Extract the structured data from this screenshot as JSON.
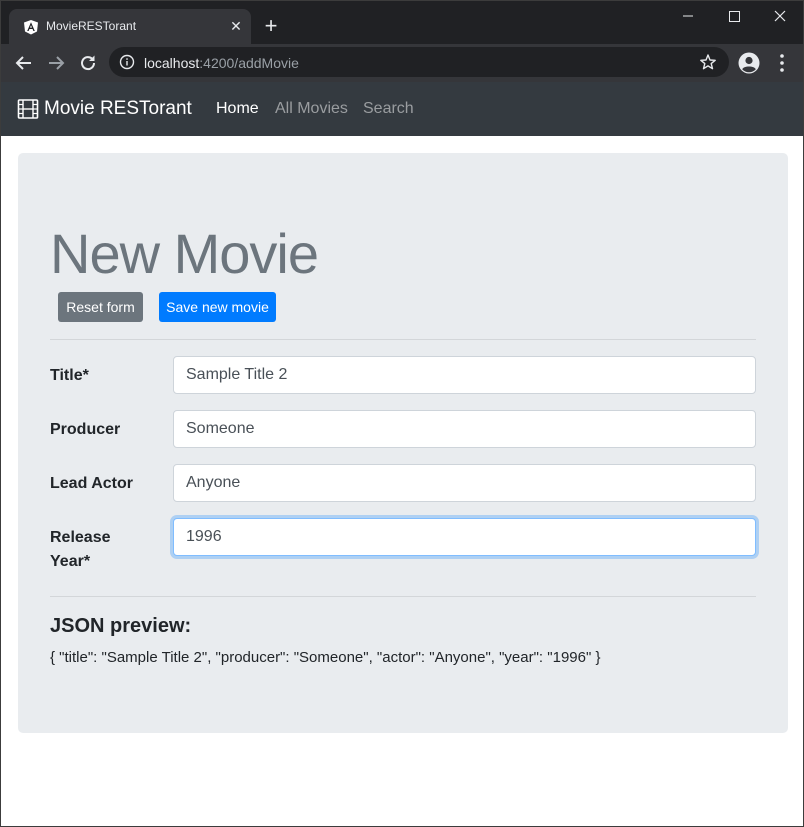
{
  "browser": {
    "tab_title": "MovieRESTorant",
    "url_host": "localhost",
    "url_rest": ":4200/addMovie"
  },
  "navbar": {
    "brand": "Movie RESTorant",
    "links": [
      {
        "label": "Home",
        "active": true
      },
      {
        "label": "All Movies",
        "active": false
      },
      {
        "label": "Search",
        "active": false
      }
    ]
  },
  "page": {
    "title": "New Movie",
    "reset_button": "Reset form",
    "save_button": "Save new movie"
  },
  "form": {
    "fields": [
      {
        "label": "Title*",
        "value": "Sample Title 2"
      },
      {
        "label": "Producer",
        "value": "Someone"
      },
      {
        "label": "Lead Actor",
        "value": "Anyone"
      },
      {
        "label_line1": "Release",
        "label_line2": "Year*",
        "value": "1996"
      }
    ]
  },
  "json_preview": {
    "heading": "JSON preview:",
    "text": "{ \"title\": \"Sample Title 2\", \"producer\": \"Someone\", \"actor\": \"Anyone\", \"year\": \"1996\" }"
  },
  "colors": {
    "navbar_bg": "#343a40",
    "primary": "#007bff",
    "secondary": "#6c757d",
    "jumbotron_bg": "#e9ecef"
  },
  "icons": [
    "angular-favicon-icon",
    "close-icon",
    "plus-icon",
    "minimize-icon",
    "maximize-icon",
    "window-close-icon",
    "back-icon",
    "forward-icon",
    "reload-icon",
    "info-icon",
    "star-icon",
    "profile-icon",
    "kebab-menu-icon",
    "film-icon"
  ]
}
